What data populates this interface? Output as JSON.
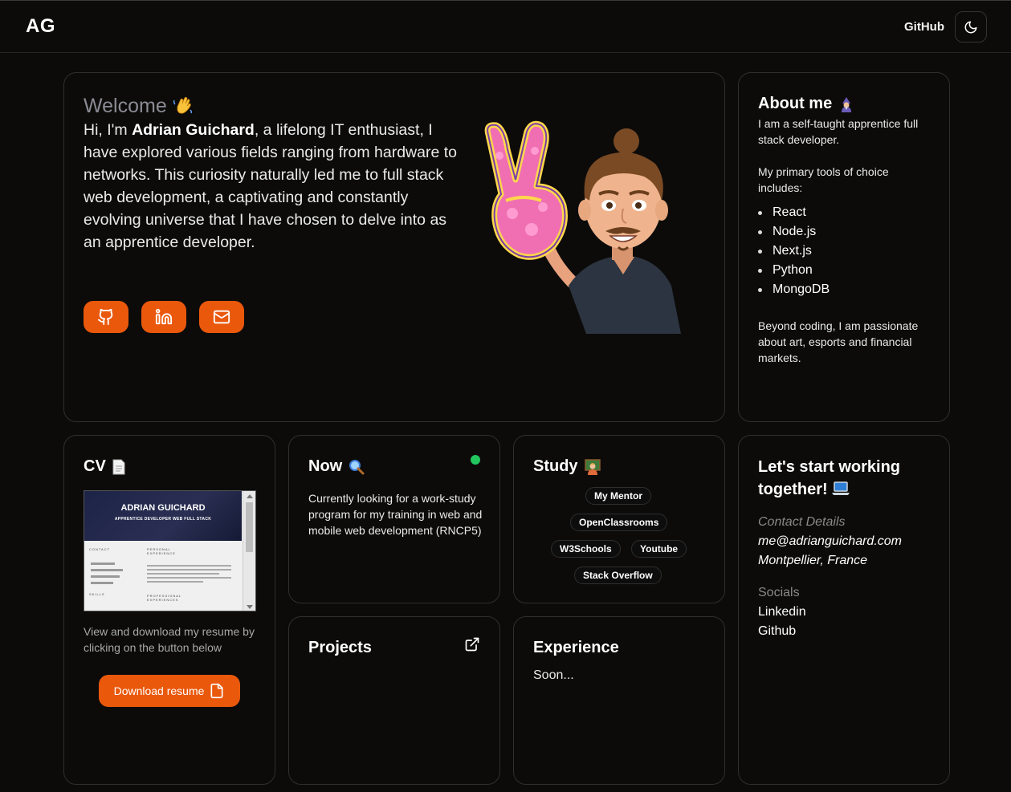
{
  "header": {
    "logo": "AG",
    "github_link": "GitHub",
    "theme_icon": "moon-icon"
  },
  "welcome": {
    "title": "Welcome",
    "title_emoji": "waving-hand",
    "intro_prefix": "Hi, I'm ",
    "name": "Adrian Guichard",
    "intro_rest": ", a lifelong IT enthusiast, I have explored various fields ranging from hardware to networks. This curiosity naturally led me to full stack web development, a captivating and constantly evolving universe that I have chosen to delve into as an apprentice developer.",
    "socials": [
      {
        "icon": "github-icon"
      },
      {
        "icon": "linkedin-icon"
      },
      {
        "icon": "mail-icon"
      }
    ],
    "avatar_icon": "peace-sign-avatar"
  },
  "about": {
    "title": "About me",
    "title_emoji": "mage",
    "p1": "I am a self-taught apprentice full stack developer.",
    "p2": "My primary tools of choice includes:",
    "tools": [
      "React",
      "Node.js",
      "Next.js",
      "Python",
      "MongoDB"
    ],
    "p3": "Beyond coding, I am passionate about art, esports and financial markets."
  },
  "cv": {
    "title": "CV",
    "title_emoji": "page",
    "preview": {
      "name": "ADRIAN GUICHARD",
      "subtitle": "APPRENTICE DEVELOPER WEB FULL STACK",
      "contact_header": "CONTACT",
      "personal_header": "PERSONAL EXPERIENCE",
      "skills_header": "SKILLS",
      "professional_header": "PROFESSIONAL EXPERIENCES"
    },
    "description": "View and download my resume by clicking on the button below",
    "download_label": "Download resume"
  },
  "now": {
    "title": "Now",
    "title_emoji": "magnifier",
    "status_color": "#22c55e",
    "text": "Currently looking for a work-study program for my training in web and mobile web development (RNCP5)"
  },
  "study": {
    "title": "Study",
    "title_emoji": "teacher",
    "tags": [
      "My Mentor",
      "OpenClassrooms",
      "W3Schools",
      "Youtube",
      "Stack Overflow"
    ]
  },
  "contact": {
    "title": "Let's start working together!",
    "title_emoji": "laptop",
    "details_label": "Contact Details",
    "email": "me@adrianguichard.com",
    "location": "Montpellier, France",
    "socials_label": "Socials",
    "social_links": [
      "Linkedin",
      "Github"
    ]
  },
  "projects": {
    "title": "Projects",
    "link_icon": "external-link-icon"
  },
  "experience": {
    "title": "Experience",
    "text": "Soon..."
  },
  "colors": {
    "accent": "#ea580c",
    "background": "#0c0b0a",
    "border": "#2f2f2f"
  }
}
